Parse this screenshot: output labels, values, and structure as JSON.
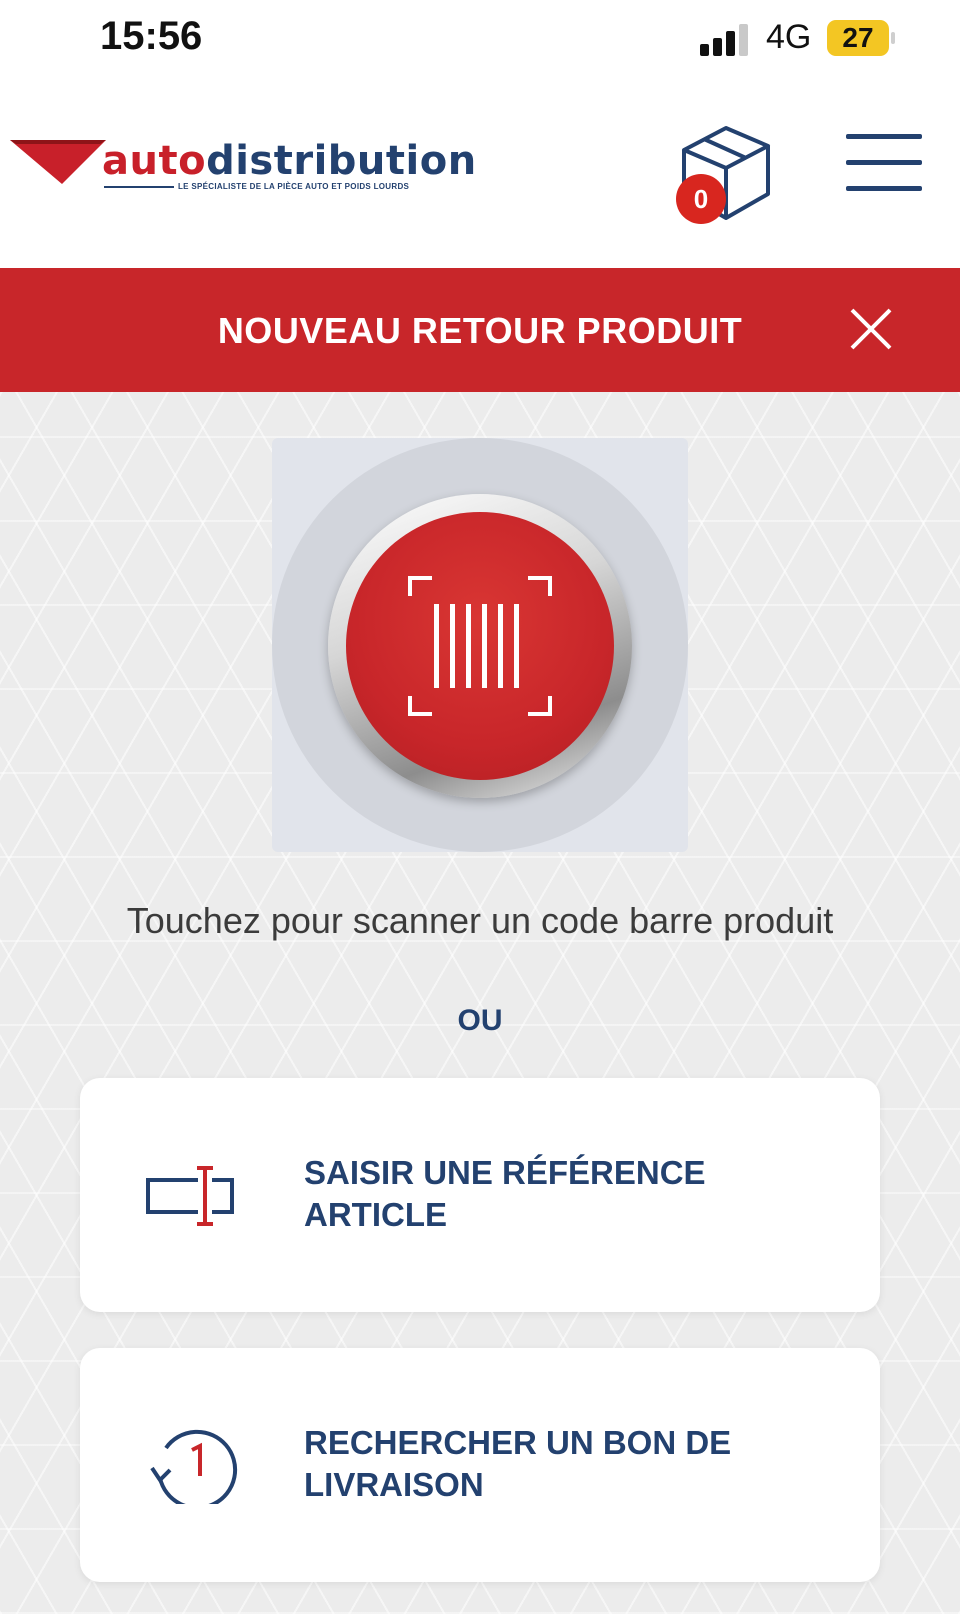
{
  "status_bar": {
    "time": "15:56",
    "network": "4G",
    "battery": "27"
  },
  "header": {
    "logo": {
      "red_part": "auto",
      "blue_part": "distribution",
      "tagline": "LE SPÉCIALISTE DE LA PIÈCE AUTO ET POIDS LOURDS"
    },
    "cart_count": "0",
    "cart_icon": "box-icon",
    "menu_icon": "hamburger-menu-icon"
  },
  "banner": {
    "title": "NOUVEAU RETOUR PRODUIT",
    "close_icon": "close-icon"
  },
  "scan": {
    "icon": "barcode-scan-icon",
    "caption": "Touchez pour scanner un code barre produit"
  },
  "separator": "OU",
  "options": [
    {
      "icon": "text-input-cursor-icon",
      "label": "SAISIR UNE RÉFÉRENCE ARTICLE"
    },
    {
      "icon": "history-clock-icon",
      "label": "RECHERCHER UN BON DE LIVRAISON"
    }
  ],
  "colors": {
    "brand_red": "#c8262a",
    "brand_blue": "#23416f",
    "background": "#ececec"
  }
}
